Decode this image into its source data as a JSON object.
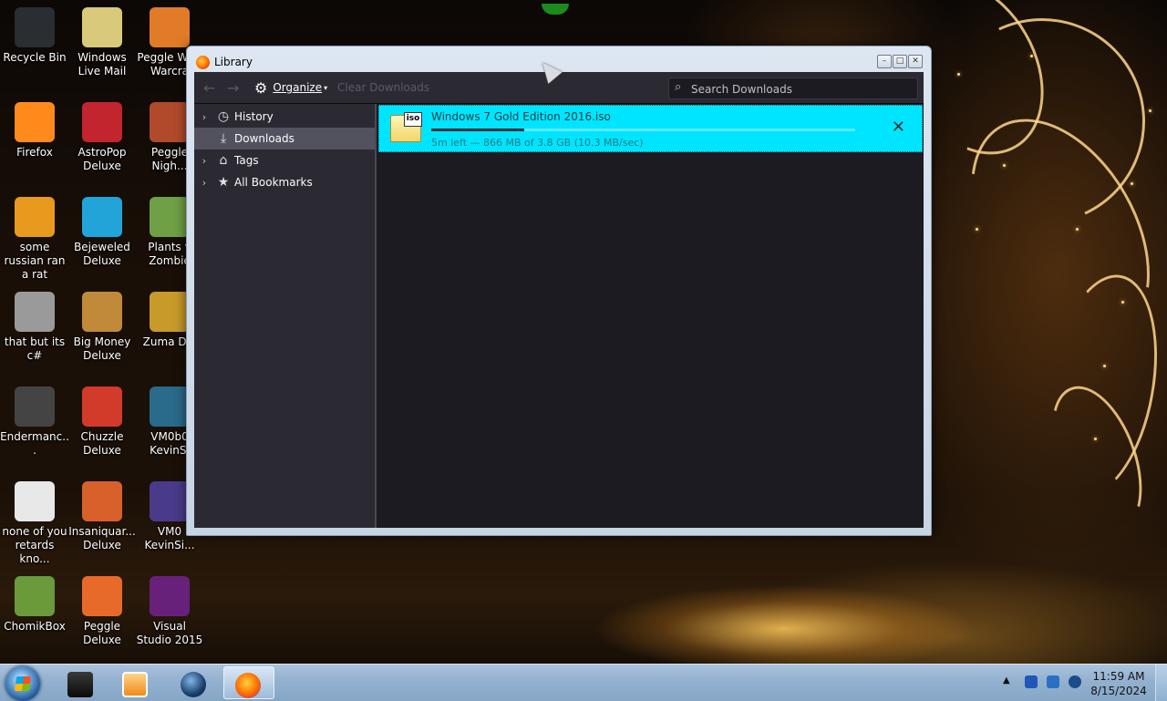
{
  "desktop": {
    "icons": [
      {
        "label": "Recycle Bin",
        "color": "#2a2d31"
      },
      {
        "label": "Windows Live Mail",
        "color": "#d9c97a"
      },
      {
        "label": "Peggle W of Warcra",
        "color": "#e27b28"
      },
      {
        "label": "Firefox",
        "color": "#ff8a1c"
      },
      {
        "label": "AstroPop Deluxe",
        "color": "#c2252e"
      },
      {
        "label": "Peggle Nigh...",
        "color": "#b14a2a"
      },
      {
        "label": "some russian ran a rat",
        "color": "#e89a1e"
      },
      {
        "label": "Bejeweled Deluxe",
        "color": "#22a4d8"
      },
      {
        "label": "Plants v Zombie",
        "color": "#6fa045"
      },
      {
        "label": "that but its c#",
        "color": "#9a9a9a"
      },
      {
        "label": "Big Money Deluxe",
        "color": "#c08a3a"
      },
      {
        "label": "Zuma Del",
        "color": "#c79a2a"
      },
      {
        "label": "Endermanc...",
        "color": "#444444"
      },
      {
        "label": "Chuzzle Deluxe",
        "color": "#d23a2a"
      },
      {
        "label": "VM0b0 KevinSi",
        "color": "#2a6a8a"
      },
      {
        "label": "none of you retards kno...",
        "color": "#e8e8e8"
      },
      {
        "label": "Insaniquar... Deluxe",
        "color": "#d8602a"
      },
      {
        "label": "VM0 KevinSi...",
        "color": "#4a3a8a"
      },
      {
        "label": "ChomikBox",
        "color": "#6a9a3a"
      },
      {
        "label": "Peggle Deluxe",
        "color": "#e86a2a"
      },
      {
        "label": "Visual Studio 2015",
        "color": "#68217a"
      }
    ]
  },
  "window": {
    "title": "Library",
    "controls": {
      "minimize": "–",
      "maximize": "□",
      "close": "✕"
    }
  },
  "toolbar": {
    "back_icon": "←",
    "forward_icon": "→",
    "organize_label": "Organize",
    "clear_label": "Clear Downloads",
    "search_placeholder": "Search Downloads",
    "search_value": ""
  },
  "sidebar": {
    "items": [
      {
        "label": "History",
        "icon": "clock-icon",
        "glyph": "◷",
        "twisty": "›",
        "selected": false
      },
      {
        "label": "Downloads",
        "icon": "download-icon",
        "glyph": "⤓",
        "twisty": "",
        "selected": true
      },
      {
        "label": "Tags",
        "icon": "tag-icon",
        "glyph": "⌂",
        "twisty": "›",
        "selected": false
      },
      {
        "label": "All Bookmarks",
        "icon": "star-icon",
        "glyph": "★",
        "twisty": "›",
        "selected": false
      }
    ]
  },
  "downloads": [
    {
      "filename": "Windows 7 Gold Edition 2016.iso",
      "file_tag": "iso",
      "status": "5m left — 866 MB of 3.8 GB (10.3 MB/sec)",
      "progress": 0.22,
      "cancel_glyph": "✕"
    }
  ],
  "taskbar": {
    "apps": [
      "cmd-app",
      "media-player-app",
      "globe-app",
      "firefox-app"
    ],
    "clock": {
      "time": "11:59 AM",
      "date": "8/15/2024"
    },
    "tray_expand": "▲"
  },
  "colors": {
    "selection": "#00e5ff",
    "sidebar_bg": "#2b2a33",
    "content_bg": "#1c1b22",
    "taskbar": "#93b1cf"
  }
}
